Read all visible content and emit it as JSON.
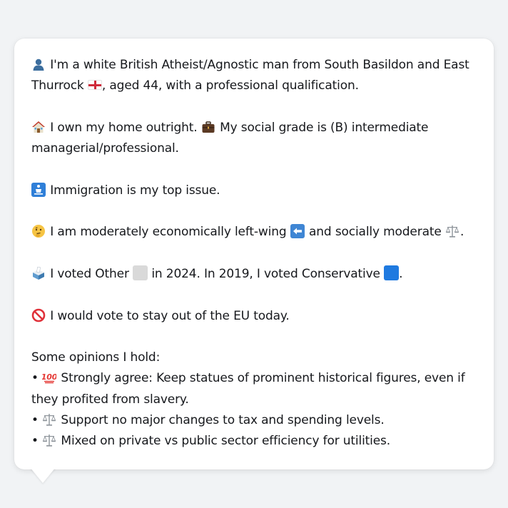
{
  "colors": {
    "background": "#f1f3f5",
    "card": "#ffffff",
    "text": "#16181c",
    "other_party": "#d9d9d9",
    "conservative": "#1f7ae0"
  },
  "profile": {
    "line1_text": "I'm a white British Atheist/Agnostic man from South Basildon and East Thurrock",
    "line1_suffix": ", aged 44, with a professional qualification.",
    "home_text": "I own my home outright.",
    "grade_text": "My social grade is (B) intermediate managerial/professional.",
    "issue_text": "Immigration is my top issue.",
    "econ_text": "I am moderately economically left-wing",
    "social_text": "and socially moderate",
    "social_suffix": ".",
    "vote_text_a": "I voted Other",
    "vote_text_b": "in 2024. In 2019, I voted Conservative",
    "vote_suffix": ".",
    "eu_text": "I would vote to stay out of the EU today."
  },
  "opinions": {
    "heading": "Some opinions I hold:",
    "bullet": "•",
    "items": [
      {
        "icon": "hundred-points-icon",
        "text": "Strongly agree: Keep statues of prominent historical figures, even if they profited from slavery."
      },
      {
        "icon": "balance-scale-icon",
        "text": "Support no major changes to tax and spending levels."
      },
      {
        "icon": "balance-scale-icon",
        "text": "Mixed on private vs public sector efficiency for utilities."
      }
    ]
  },
  "icons": {
    "person": "person-silhouette-icon",
    "flag": "england-flag-icon",
    "house": "house-icon",
    "briefcase": "briefcase-icon",
    "passport": "passport-control-icon",
    "thinking": "thinking-face-icon",
    "left_arrow": "left-arrow-icon",
    "scale": "balance-scale-icon",
    "ballot": "ballot-box-icon",
    "no_entry": "prohibited-icon"
  }
}
